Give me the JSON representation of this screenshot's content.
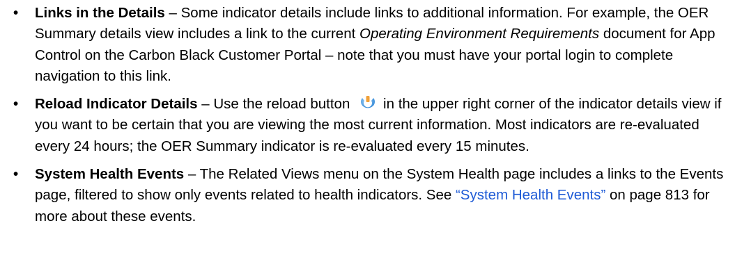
{
  "items": [
    {
      "bullet": "•",
      "term": "Links in the Details",
      "text1": " – Some indicator details include links to additional information. For example, the OER Summary details view includes a link to the current ",
      "italic": "Operating Environment Requirements",
      "text2": " document for App Control on the Carbon Black Customer Portal – note that you must have your portal login to complete navigation to this link."
    },
    {
      "bullet": "•",
      "term": "Reload Indicator Details",
      "text1": " – Use the reload button ",
      "icon": "reload-icon",
      "text2": "in the upper right corner of the indicator details view if you want to be certain that you are viewing the most current information. Most indicators are re-evaluated every 24 hours; the OER Summary indicator is re-evaluated every 15 minutes."
    },
    {
      "bullet": "•",
      "term": "System Health Events",
      "text1": " – The Related Views menu on the System Health page includes a links to the Events page, filtered to show only events related to health indicators. See ",
      "link": "“System Health Events”",
      "text2": " on page 813 for more about these events."
    }
  ],
  "colors": {
    "link": "#1f5bd6",
    "icon_blue": "#2f86d6",
    "icon_orange": "#f0a13a"
  }
}
